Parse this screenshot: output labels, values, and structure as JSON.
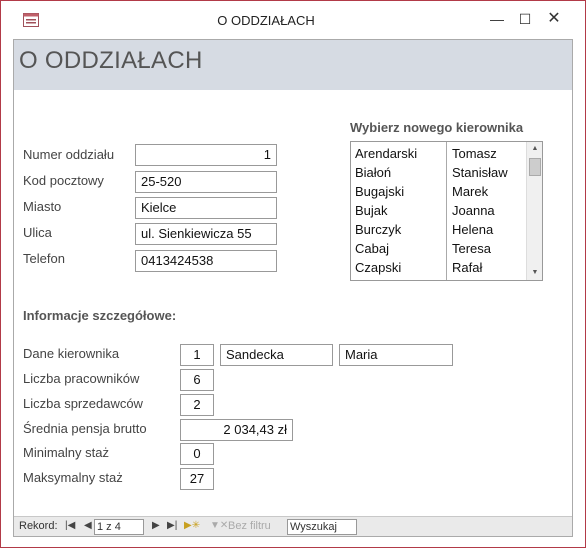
{
  "window": {
    "title": "O ODDZIAŁACH"
  },
  "header": {
    "title": "O ODDZIAŁACH"
  },
  "branch": {
    "numer_label": "Numer oddziału",
    "numer_value": "1",
    "kod_label": "Kod pocztowy",
    "kod_value": "25-520",
    "miasto_label": "Miasto",
    "miasto_value": "Kielce",
    "ulica_label": "Ulica",
    "ulica_value": "ul. Sienkiewicza 55",
    "telefon_label": "Telefon",
    "telefon_value": "0413424538"
  },
  "manager_picker": {
    "title": "Wybierz nowego kierownika",
    "rows": [
      {
        "surname": "Arendarski",
        "name": "Tomasz"
      },
      {
        "surname": "Białoń",
        "name": "Stanisław"
      },
      {
        "surname": "Bugajski",
        "name": "Marek"
      },
      {
        "surname": "Bujak",
        "name": "Joanna"
      },
      {
        "surname": "Burczyk",
        "name": "Helena"
      },
      {
        "surname": "Cabaj",
        "name": "Teresa"
      },
      {
        "surname": "Czapski",
        "name": "Rafał"
      }
    ]
  },
  "details": {
    "title": "Informacje szczegółowe:",
    "dane_label": "Dane kierownika",
    "dane_id": "1",
    "dane_surname": "Sandecka",
    "dane_name": "Maria",
    "pracownicy_label": "Liczba pracowników",
    "pracownicy_value": "6",
    "sprzedawcy_label": "Liczba sprzedawców",
    "sprzedawcy_value": "2",
    "pensja_label": "Średnia pensja brutto",
    "pensja_value": "2 034,43 zł",
    "minstaz_label": "Minimalny staż",
    "minstaz_value": "0",
    "maxstaz_label": "Maksymalny staż",
    "maxstaz_value": "27"
  },
  "navigation": {
    "record_label": "Rekord:",
    "position": "1 z 4",
    "filter_label": "Bez filtru",
    "search_value": "Wyszukaj"
  }
}
